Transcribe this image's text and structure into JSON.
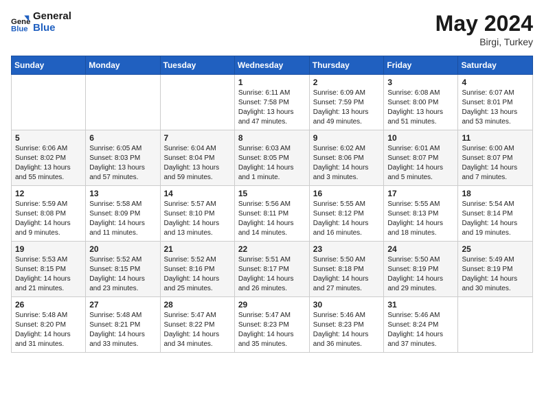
{
  "header": {
    "logo_general": "General",
    "logo_blue": "Blue",
    "month_year": "May 2024",
    "location": "Birgi, Turkey"
  },
  "weekdays": [
    "Sunday",
    "Monday",
    "Tuesday",
    "Wednesday",
    "Thursday",
    "Friday",
    "Saturday"
  ],
  "weeks": [
    [
      {
        "day": "",
        "info": ""
      },
      {
        "day": "",
        "info": ""
      },
      {
        "day": "",
        "info": ""
      },
      {
        "day": "1",
        "info": "Sunrise: 6:11 AM\nSunset: 7:58 PM\nDaylight: 13 hours\nand 47 minutes."
      },
      {
        "day": "2",
        "info": "Sunrise: 6:09 AM\nSunset: 7:59 PM\nDaylight: 13 hours\nand 49 minutes."
      },
      {
        "day": "3",
        "info": "Sunrise: 6:08 AM\nSunset: 8:00 PM\nDaylight: 13 hours\nand 51 minutes."
      },
      {
        "day": "4",
        "info": "Sunrise: 6:07 AM\nSunset: 8:01 PM\nDaylight: 13 hours\nand 53 minutes."
      }
    ],
    [
      {
        "day": "5",
        "info": "Sunrise: 6:06 AM\nSunset: 8:02 PM\nDaylight: 13 hours\nand 55 minutes."
      },
      {
        "day": "6",
        "info": "Sunrise: 6:05 AM\nSunset: 8:03 PM\nDaylight: 13 hours\nand 57 minutes."
      },
      {
        "day": "7",
        "info": "Sunrise: 6:04 AM\nSunset: 8:04 PM\nDaylight: 13 hours\nand 59 minutes."
      },
      {
        "day": "8",
        "info": "Sunrise: 6:03 AM\nSunset: 8:05 PM\nDaylight: 14 hours\nand 1 minute."
      },
      {
        "day": "9",
        "info": "Sunrise: 6:02 AM\nSunset: 8:06 PM\nDaylight: 14 hours\nand 3 minutes."
      },
      {
        "day": "10",
        "info": "Sunrise: 6:01 AM\nSunset: 8:07 PM\nDaylight: 14 hours\nand 5 minutes."
      },
      {
        "day": "11",
        "info": "Sunrise: 6:00 AM\nSunset: 8:07 PM\nDaylight: 14 hours\nand 7 minutes."
      }
    ],
    [
      {
        "day": "12",
        "info": "Sunrise: 5:59 AM\nSunset: 8:08 PM\nDaylight: 14 hours\nand 9 minutes."
      },
      {
        "day": "13",
        "info": "Sunrise: 5:58 AM\nSunset: 8:09 PM\nDaylight: 14 hours\nand 11 minutes."
      },
      {
        "day": "14",
        "info": "Sunrise: 5:57 AM\nSunset: 8:10 PM\nDaylight: 14 hours\nand 13 minutes."
      },
      {
        "day": "15",
        "info": "Sunrise: 5:56 AM\nSunset: 8:11 PM\nDaylight: 14 hours\nand 14 minutes."
      },
      {
        "day": "16",
        "info": "Sunrise: 5:55 AM\nSunset: 8:12 PM\nDaylight: 14 hours\nand 16 minutes."
      },
      {
        "day": "17",
        "info": "Sunrise: 5:55 AM\nSunset: 8:13 PM\nDaylight: 14 hours\nand 18 minutes."
      },
      {
        "day": "18",
        "info": "Sunrise: 5:54 AM\nSunset: 8:14 PM\nDaylight: 14 hours\nand 19 minutes."
      }
    ],
    [
      {
        "day": "19",
        "info": "Sunrise: 5:53 AM\nSunset: 8:15 PM\nDaylight: 14 hours\nand 21 minutes."
      },
      {
        "day": "20",
        "info": "Sunrise: 5:52 AM\nSunset: 8:15 PM\nDaylight: 14 hours\nand 23 minutes."
      },
      {
        "day": "21",
        "info": "Sunrise: 5:52 AM\nSunset: 8:16 PM\nDaylight: 14 hours\nand 25 minutes."
      },
      {
        "day": "22",
        "info": "Sunrise: 5:51 AM\nSunset: 8:17 PM\nDaylight: 14 hours\nand 26 minutes."
      },
      {
        "day": "23",
        "info": "Sunrise: 5:50 AM\nSunset: 8:18 PM\nDaylight: 14 hours\nand 27 minutes."
      },
      {
        "day": "24",
        "info": "Sunrise: 5:50 AM\nSunset: 8:19 PM\nDaylight: 14 hours\nand 29 minutes."
      },
      {
        "day": "25",
        "info": "Sunrise: 5:49 AM\nSunset: 8:19 PM\nDaylight: 14 hours\nand 30 minutes."
      }
    ],
    [
      {
        "day": "26",
        "info": "Sunrise: 5:48 AM\nSunset: 8:20 PM\nDaylight: 14 hours\nand 31 minutes."
      },
      {
        "day": "27",
        "info": "Sunrise: 5:48 AM\nSunset: 8:21 PM\nDaylight: 14 hours\nand 33 minutes."
      },
      {
        "day": "28",
        "info": "Sunrise: 5:47 AM\nSunset: 8:22 PM\nDaylight: 14 hours\nand 34 minutes."
      },
      {
        "day": "29",
        "info": "Sunrise: 5:47 AM\nSunset: 8:23 PM\nDaylight: 14 hours\nand 35 minutes."
      },
      {
        "day": "30",
        "info": "Sunrise: 5:46 AM\nSunset: 8:23 PM\nDaylight: 14 hours\nand 36 minutes."
      },
      {
        "day": "31",
        "info": "Sunrise: 5:46 AM\nSunset: 8:24 PM\nDaylight: 14 hours\nand 37 minutes."
      },
      {
        "day": "",
        "info": ""
      }
    ]
  ]
}
